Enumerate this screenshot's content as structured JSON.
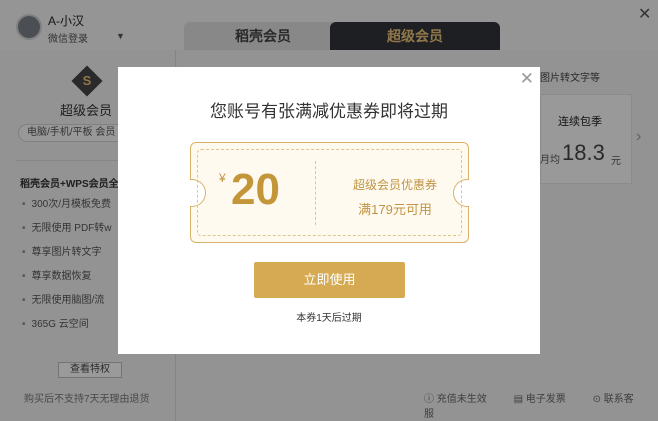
{
  "topbar": {
    "user_name": "A-小汉",
    "login_type": "微信登录",
    "tabs": [
      {
        "label": "稻壳会员"
      },
      {
        "label": "超级会员"
      }
    ]
  },
  "left_panel": {
    "badge_letter": "S",
    "title": "超级会员",
    "devices": "电脑/手机/平板 会员",
    "section_head": "稻壳会员+WPS会员全",
    "benefits": [
      "300次/月模板免费",
      "无限使用 PDF转w",
      "尊享图片转文字",
      "尊享数据恢复",
      "无限使用脑图/流",
      "365G 云空间"
    ],
    "view_button": "查看特权",
    "note": "购买后不支持7天无理由退货"
  },
  "right_panel": {
    "feature_text": "图片转文字等",
    "plan_name": "连续包季",
    "price_prefix": "月均",
    "price": "18.3",
    "price_suffix": "元",
    "footer_links": [
      "充值未生效",
      "电子发票",
      "联系客服"
    ]
  },
  "modal": {
    "title": "您账号有张满减优惠券即将过期",
    "coupon": {
      "currency": "¥",
      "amount": "20",
      "name": "超级会员优惠券",
      "condition": "满179元可用"
    },
    "use_button": "立即使用",
    "expiry_text": "本券1天后过期"
  },
  "colors": {
    "gold": "#d5aa52",
    "dark_tab": "#2f3338",
    "coupon_text": "#c09443"
  }
}
